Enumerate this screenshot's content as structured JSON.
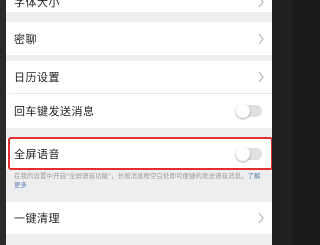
{
  "settings": {
    "items": [
      {
        "label": "字体大小",
        "control": "chevron"
      },
      {
        "label": "密聊",
        "control": "chevron"
      },
      {
        "label": "日历设置",
        "control": "chevron"
      },
      {
        "label": "回车键发送消息",
        "control": "toggle",
        "state": "off"
      },
      {
        "label": "全屏语音",
        "control": "toggle",
        "state": "off",
        "highlighted": true
      },
      {
        "label": "一键清理",
        "control": "chevron"
      }
    ],
    "fullscreen_voice_description": "在我的设置中开启\"全屏语音功能\"，长按消息框空白处即可便捷的发送语音消息。",
    "learn_more_link": "了解更多"
  },
  "colors": {
    "highlight_border": "#e03030",
    "toggle_off": "#e0e0e0",
    "link": "#5b7fb5",
    "page_background": "#eeeeef"
  }
}
